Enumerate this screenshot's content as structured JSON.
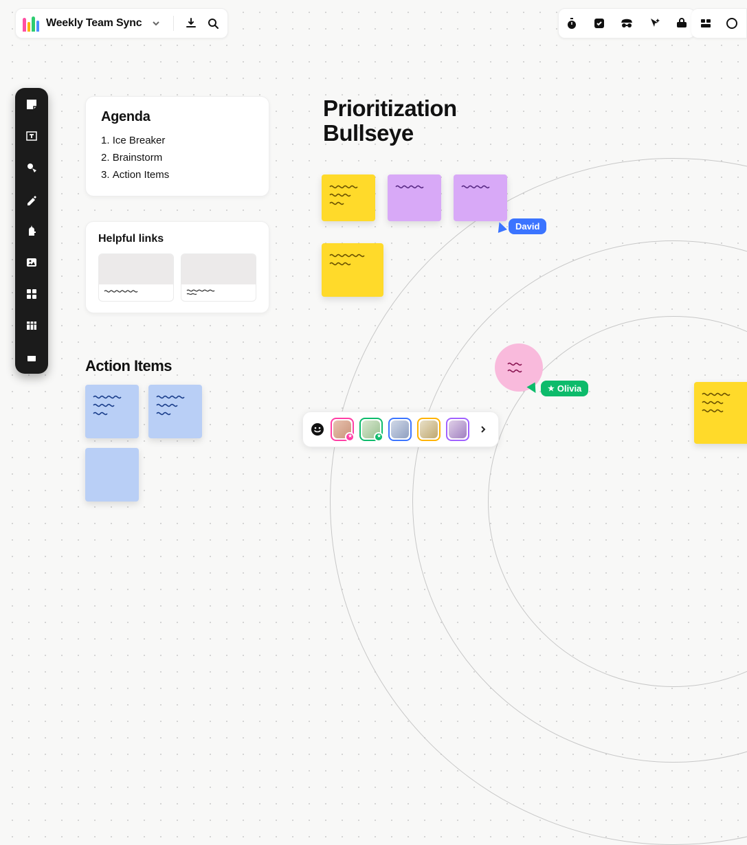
{
  "header": {
    "board_title": "Weekly Team Sync"
  },
  "sidebar_tools": [
    "sticky-note",
    "text-box",
    "shapes",
    "pen",
    "llama",
    "image",
    "grid",
    "table",
    "slide"
  ],
  "top_tools": [
    "timer",
    "checkbox",
    "incognito",
    "cursor",
    "toolbox"
  ],
  "top_tools2": [
    "layout",
    "settings"
  ],
  "agenda": {
    "title": "Agenda",
    "items": [
      "Ice Breaker",
      "Brainstorm",
      "Action Items"
    ]
  },
  "links": {
    "title": "Helpful links"
  },
  "action_items": {
    "title": "Action Items"
  },
  "bullseye": {
    "title": "Prioritization\nBullseye"
  },
  "cursors": {
    "david": "David",
    "olivia": "Olivia"
  },
  "participants": {
    "count": 5
  }
}
